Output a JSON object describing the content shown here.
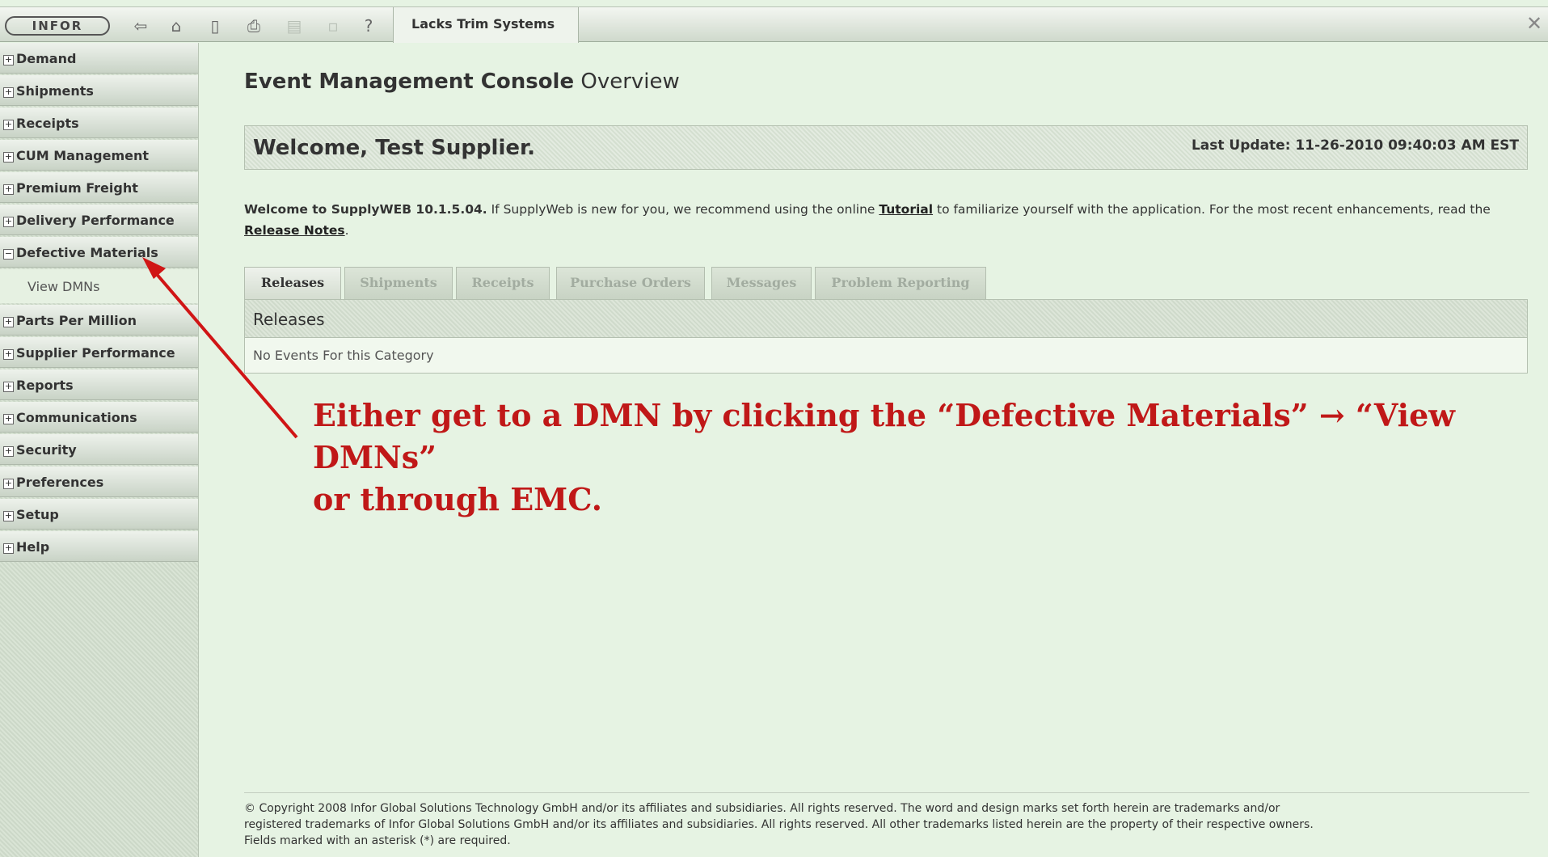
{
  "topbar": {
    "logo_text": "INFOR",
    "icons": [
      "back-icon",
      "home-icon",
      "page-icon",
      "print-icon",
      "export-icon",
      "lock-icon",
      "help-icon"
    ],
    "app_tab_label": "Lacks Trim Systems",
    "close_glyph": "✕"
  },
  "sidebar": {
    "items": [
      {
        "label": "Demand",
        "state": "+"
      },
      {
        "label": "Shipments",
        "state": "+"
      },
      {
        "label": "Receipts",
        "state": "+"
      },
      {
        "label": "CUM Management",
        "state": "+"
      },
      {
        "label": "Premium Freight",
        "state": "+"
      },
      {
        "label": "Delivery Performance",
        "state": "+"
      },
      {
        "label": "Defective Materials",
        "state": "−"
      },
      {
        "label": "Parts Per Million",
        "state": "+"
      },
      {
        "label": "Supplier Performance",
        "state": "+"
      },
      {
        "label": "Reports",
        "state": "+"
      },
      {
        "label": "Communications",
        "state": "+"
      },
      {
        "label": "Security",
        "state": "+"
      },
      {
        "label": "Preferences",
        "state": "+"
      },
      {
        "label": "Setup",
        "state": "+"
      },
      {
        "label": "Help",
        "state": "+"
      }
    ],
    "sub_item_label": "View DMNs"
  },
  "main": {
    "title_bold": "Event Management Console",
    "title_rest": " Overview",
    "welcome": "Welcome, Test Supplier.",
    "last_update": "Last Update: 11-26-2010 09:40:03 AM EST",
    "intro": {
      "lead": "Welcome to SupplyWEB 10.1.5.04.",
      "text1": " If SupplyWeb is new for you, we recommend using the online ",
      "tutorial_link": "Tutorial",
      "text2": " to familiarize yourself with the application. For the most recent enhancements, read the ",
      "release_notes_link": "Release Notes",
      "text3": "."
    },
    "tabs": [
      "Releases",
      "Shipments",
      "Receipts",
      "Purchase Orders",
      "Messages",
      "Problem Reporting"
    ],
    "section_header": "Releases",
    "empty_message": "No Events For this Category"
  },
  "annotation": {
    "line1": "Either get to a DMN by clicking the “Defective Materials” → “View DMNs”",
    "line2": "or through EMC.",
    "color": "#c01818"
  },
  "footer": {
    "line1": "© Copyright 2008 Infor Global Solutions Technology GmbH and/or its affiliates and subsidiaries. All rights reserved. The word and design marks set forth herein are trademarks and/or",
    "line2": "registered trademarks of Infor Global Solutions GmbH and/or its affiliates and subsidiaries. All rights reserved. All other trademarks listed herein are the property of their respective owners.",
    "line3": "Fields marked with an asterisk (*) are required."
  }
}
